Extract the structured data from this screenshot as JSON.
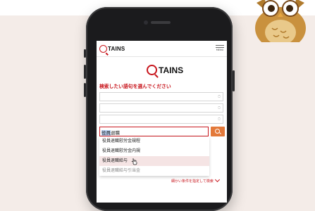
{
  "app": {
    "logo_text": "TAINS",
    "menu_label": "MENU"
  },
  "main": {
    "heading": "検索したい語句を選んでください",
    "search": {
      "value_highlight": "役員",
      "value_rest": "退職",
      "button_icon": "search-icon"
    },
    "suggestions": [
      "役員退職慰労金規程",
      "役員退職慰労金内規",
      "役員退職給与",
      "役員退職給与引当金"
    ],
    "hovered_index": 2,
    "advanced_link": "細かい条件を指定して検索"
  },
  "colors": {
    "brand_red": "#c8161d",
    "search_button": "#e3793a",
    "background": "#f4ece8"
  }
}
